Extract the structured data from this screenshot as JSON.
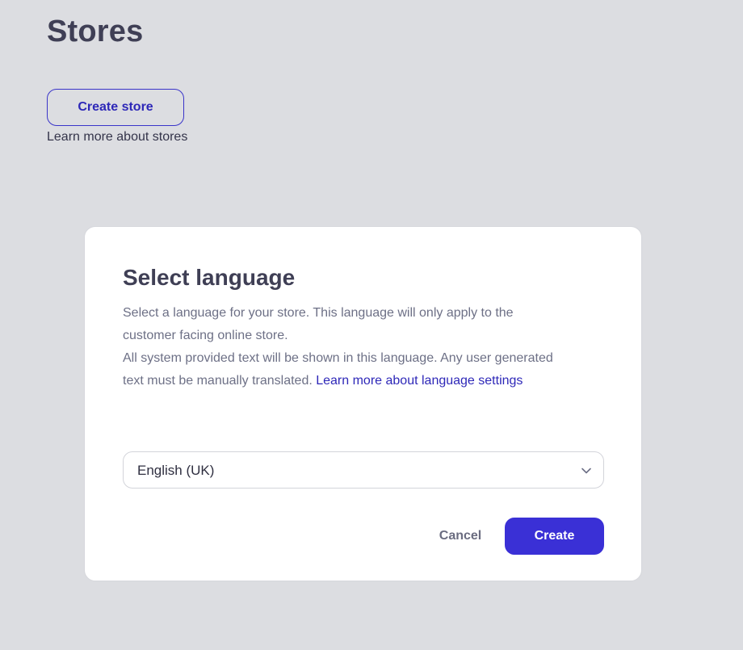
{
  "page": {
    "title": "Stores",
    "create_store_label": "Create store",
    "learn_more_label": "Learn more about stores"
  },
  "modal": {
    "title": "Select language",
    "description_line1": "Select a language for your store. This language will only apply to the",
    "description_line2": "customer facing online store.",
    "description_line3": "All system provided text will be shown in this language. Any user generated",
    "description_line4_text": "text must be manually translated. ",
    "description_link": "Learn more about language settings",
    "language_select": {
      "selected": "English (UK)",
      "icon": "chevron-down-icon"
    },
    "cancel_label": "Cancel",
    "create_label": "Create"
  },
  "colors": {
    "background": "#dcdde1",
    "accent": "#3a30d6",
    "link": "#2e28b8",
    "modal_bg": "#ffffff",
    "heading": "#3f3f55",
    "muted_text": "#6d7086"
  }
}
